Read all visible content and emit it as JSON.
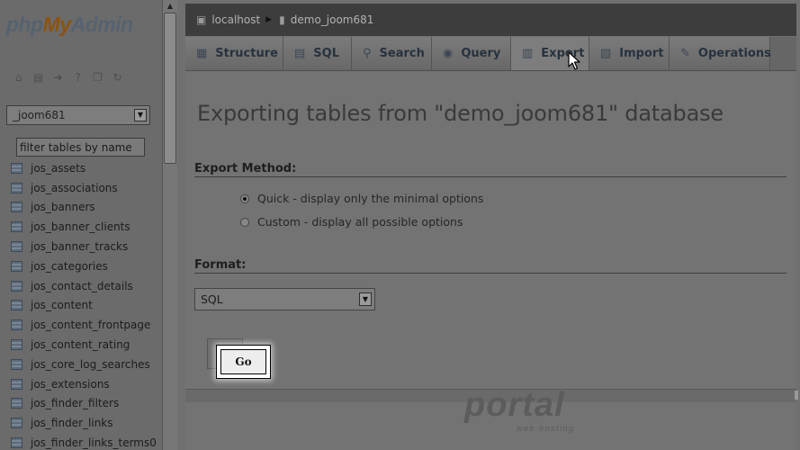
{
  "logo": {
    "part1": "php",
    "part2": "My",
    "part3": "Admin"
  },
  "sidebar": {
    "tool_icons": [
      "home-icon",
      "database-icon",
      "logout-icon",
      "help-icon",
      "docs-icon",
      "reload-icon"
    ],
    "database_select": {
      "value": "_joom681"
    },
    "filter": {
      "placeholder": "filter tables by name"
    },
    "tables": [
      "jos_assets",
      "jos_associations",
      "jos_banners",
      "jos_banner_clients",
      "jos_banner_tracks",
      "jos_categories",
      "jos_contact_details",
      "jos_content",
      "jos_content_frontpage",
      "jos_content_rating",
      "jos_core_log_searches",
      "jos_extensions",
      "jos_finder_filters",
      "jos_finder_links",
      "jos_finder_links_terms0"
    ]
  },
  "breadcrumb": {
    "server": "localhost",
    "database": "demo_joom681"
  },
  "tabs": [
    {
      "label": "Structure",
      "icon": "structure-icon"
    },
    {
      "label": "SQL",
      "icon": "sql-icon"
    },
    {
      "label": "Search",
      "icon": "search-icon"
    },
    {
      "label": "Query",
      "icon": "query-icon"
    },
    {
      "label": "Export",
      "icon": "export-icon",
      "active": true
    },
    {
      "label": "Import",
      "icon": "import-icon"
    },
    {
      "label": "Operations",
      "icon": "wrench-icon"
    }
  ],
  "main": {
    "title": "Exporting tables from \"demo_joom681\" database",
    "export_method": {
      "label": "Export Method:",
      "options": [
        {
          "label": "Quick - display only the minimal options",
          "checked": true
        },
        {
          "label": "Custom - display all possible options",
          "checked": false
        }
      ]
    },
    "format": {
      "label": "Format:",
      "value": "SQL"
    },
    "go_label": "Go"
  },
  "watermark": {
    "big": "portal",
    "small": "web hosting"
  }
}
